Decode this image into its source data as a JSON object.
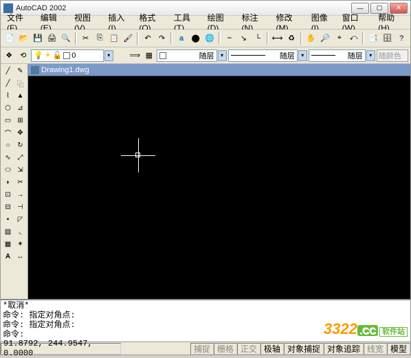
{
  "titlebar": {
    "title": "AutoCAD 2002"
  },
  "menu": {
    "items": [
      "文件(F)",
      "编辑(E)",
      "视图(V)",
      "插入(I)",
      "格式(O)",
      "工具(T)",
      "绘图(D)",
      "标注(N)",
      "修改(M)",
      "图像(I)",
      "窗口(W)",
      "帮助(H)"
    ]
  },
  "layerbar": {
    "layer_current": "0",
    "linetype": "随层",
    "lineweight": "随层",
    "color_label": "随颜色",
    "ltype_label": "随层"
  },
  "document": {
    "tab_title": "Drawing1.dwg"
  },
  "command": {
    "lines": [
      "*取消*",
      "命令:  指定对角点:",
      "命令:  指定对角点:",
      "命令:"
    ]
  },
  "status": {
    "coords": "91.8792,  244.9547, 0.0000",
    "modes": [
      "捕捉",
      "栅格",
      "正交",
      "极轴",
      "对象捕捉",
      "对象追踪",
      "线宽",
      "模型"
    ]
  },
  "watermark": {
    "num": "3322",
    "cc": ".CC",
    "sft": "软件站"
  }
}
